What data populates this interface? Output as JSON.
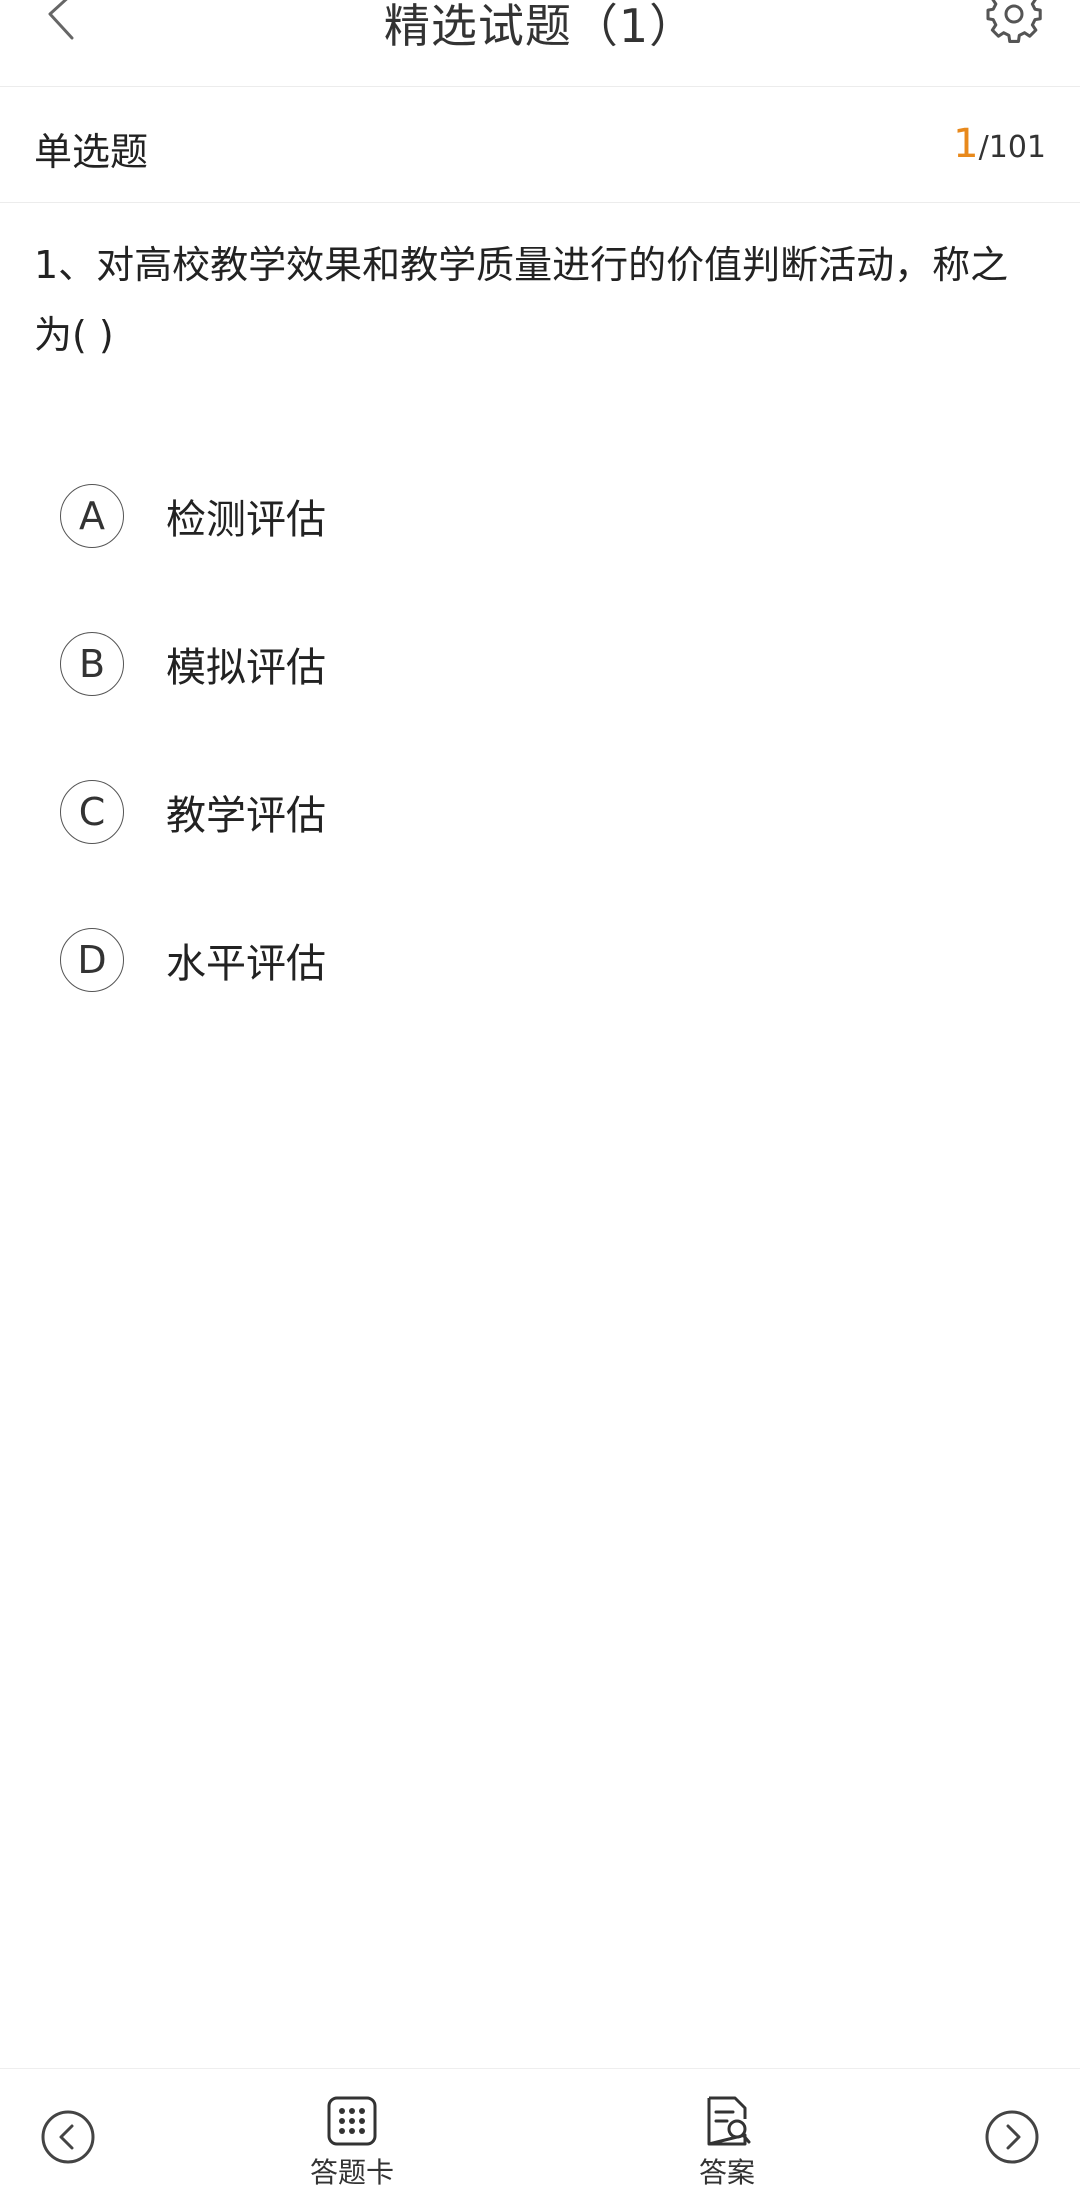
{
  "header": {
    "title": "精选试题（1）"
  },
  "question": {
    "type_label": "单选题",
    "current_index": "1",
    "total": "/101",
    "text": "1、对高校教学效果和教学质量进行的价值判断活动，称之为( )"
  },
  "options": [
    {
      "letter": "A",
      "text": "检测评估"
    },
    {
      "letter": "B",
      "text": "模拟评估"
    },
    {
      "letter": "C",
      "text": "教学评估"
    },
    {
      "letter": "D",
      "text": "水平评估"
    }
  ],
  "bottom_bar": {
    "answer_card_label": "答题卡",
    "answer_label": "答案"
  },
  "colors": {
    "accent": "#e8891c",
    "text": "#222222",
    "icon": "#555555"
  }
}
